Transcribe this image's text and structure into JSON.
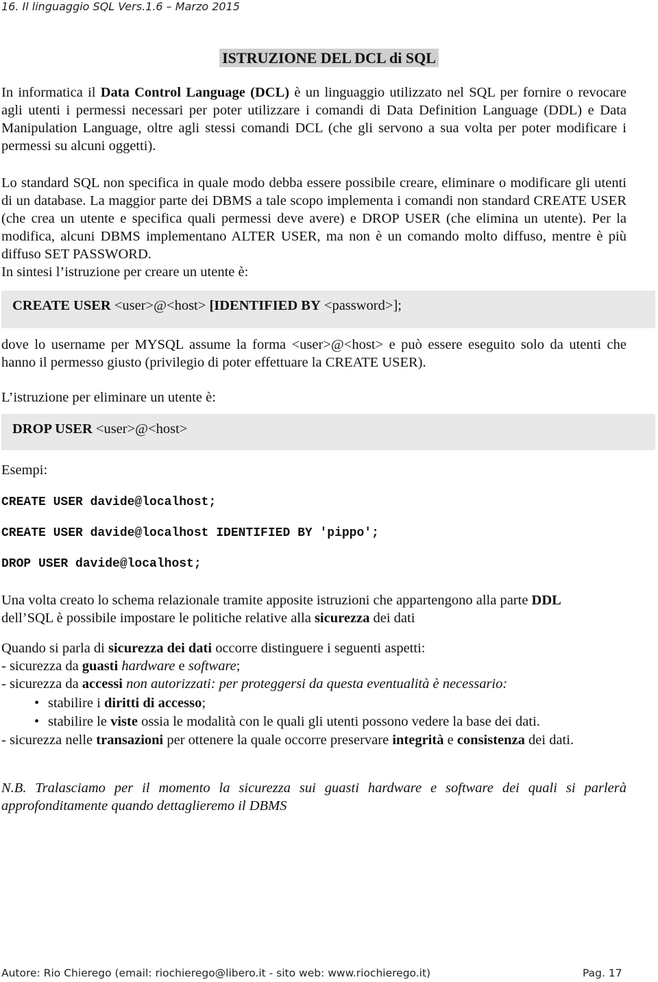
{
  "header": {
    "running_title": "16. Il linguaggio SQL  Vers.1.6 – Marzo  2015"
  },
  "title": "ISTRUZIONE DEL DCL di SQL",
  "intro": {
    "p1_a": "In informatica il ",
    "p1_bold": "Data Control Language (DCL)",
    "p1_b": " è un linguaggio utilizzato nel SQL per fornire o revocare agli utenti i permessi necessari per poter utilizzare i comandi di Data Definition Language (DDL) e Data Manipulation Language, oltre agli stessi comandi DCL (che gli servono a sua volta per poter modificare i permessi su alcuni oggetti).",
    "p2": "Lo standard SQL non specifica in quale modo debba essere possibile creare, eliminare o modificare gli utenti di un database. La maggior parte dei DBMS a tale scopo implementa i comandi non standard CREATE USER (che crea un utente e specifica quali permessi deve avere) e DROP USER (che elimina un utente). Per la modifica, alcuni DBMS implementano ALTER USER, ma non è un comando molto diffuso, mentre è più diffuso SET PASSWORD.",
    "p3": "In sintesi l’istruzione per creare un utente è:"
  },
  "create_syntax": {
    "kw1": "CREATE USER",
    "arg1": " <user>@<host> ",
    "kw2": "[IDENTIFIED BY",
    "arg2": " <password>];"
  },
  "create_note": "dove lo username per MYSQL assume la forma <user>@<host> e può essere eseguito solo da utenti che hanno il permesso giusto (privilegio di poter effettuare la CREATE USER).",
  "drop_intro": "L’istruzione per eliminare un utente è:",
  "drop_syntax": {
    "kw": "DROP USER",
    "arg": " <user>@<host>"
  },
  "examples_label": "Esempi:",
  "examples": [
    "CREATE USER davide@localhost;",
    "CREATE USER davide@localhost IDENTIFIED BY 'pippo';",
    "DROP USER davide@localhost;"
  ],
  "security": {
    "p1_a": "Una volta creato lo schema relazionale tramite apposite istruzioni che appartengono alla parte ",
    "p1_b1": "DDL",
    "p1_c": " dell’SQL è possibile impostare le politiche relative alla ",
    "p1_b2": "sicurezza",
    "p1_d": " dei dati",
    "p2_a": "Quando si parla di ",
    "p2_b": "sicurezza dei dati",
    "p2_c": " occorre distinguere i seguenti aspetti:",
    "l1_a": "- sicurezza da ",
    "l1_b": "guasti",
    "l1_sp": " ",
    "l1_i1": "hardware",
    "l1_c": " e ",
    "l1_i2": "software",
    "l1_d": ";",
    "l2_a": "- sicurezza da ",
    "l2_b": "accessi",
    "l2_i": " non autorizzati: per proteggersi da questa eventualità è necessario:",
    "bullet_glyph": "•",
    "b1_a": "stabilire i ",
    "b1_b": "diritti di accesso",
    "b1_c": ";",
    "b2_a": "stabilire le ",
    "b2_b": "viste",
    "b2_c": " ossia le modalità con le quali gli utenti possono vedere la base dei dati.",
    "l3_a": "- sicurezza nelle ",
    "l3_b1": "transazioni",
    "l3_c": " per ottenere la quale occorre preservare ",
    "l3_b2": "integrità",
    "l3_d": " e ",
    "l3_b3": "consistenza",
    "l3_e": " dei dati."
  },
  "note": "N.B. Tralasciamo per il momento la sicurezza sui guasti hardware e software dei quali si parlerà approfonditamente quando dettaglieremo il DBMS",
  "footer": {
    "author": "Autore: Rio Chierego  (email: riochierego@libero.it - sito web: www.riochierego.it)",
    "page": "Pag. 17"
  }
}
